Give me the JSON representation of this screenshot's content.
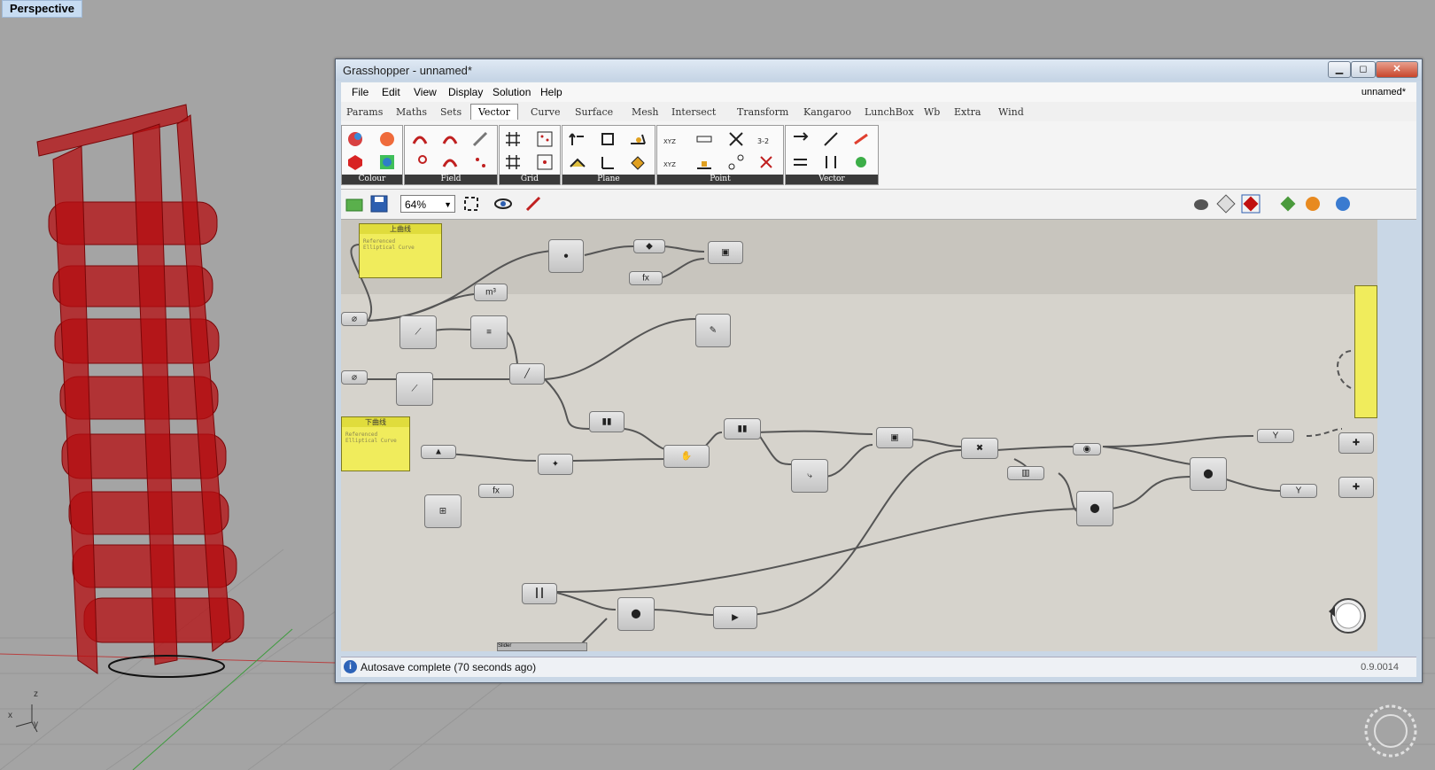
{
  "viewport": {
    "label": "Perspective",
    "axes": {
      "x": "x",
      "y": "y",
      "z": "z"
    },
    "model_color": "#b60d10"
  },
  "grasshopper": {
    "title": "Grasshopper - unnamed*",
    "document": "unnamed*",
    "menu": [
      "File",
      "Edit",
      "View",
      "Display",
      "Solution",
      "Help"
    ],
    "tabs": [
      "Params",
      "Maths",
      "Sets",
      "Vector",
      "Curve",
      "Surface",
      "Mesh",
      "Intersect",
      "Transform",
      "Kangaroo",
      "LunchBox",
      "Wb",
      "Extra",
      "Wind"
    ],
    "active_tab": "Vector",
    "panels": [
      "Colour",
      "Field",
      "Grid",
      "Plane",
      "Point",
      "Vector"
    ],
    "zoom": "64%",
    "status": "Autosave complete (70 seconds ago)",
    "version": "0.9.0014",
    "canvas": {
      "panel_top_label": "上曲线",
      "panel_bottom_label": "下曲线",
      "panel_top_content": "Referenced\nElliptical Curve",
      "panel_bottom_content": "Referenced\nElliptical Curve",
      "slider_label": "Slider"
    }
  },
  "colors": {
    "accent": "#c8d6e6",
    "panel_yellow": "#f0ec5c",
    "canvas": "#d6d3cc"
  }
}
